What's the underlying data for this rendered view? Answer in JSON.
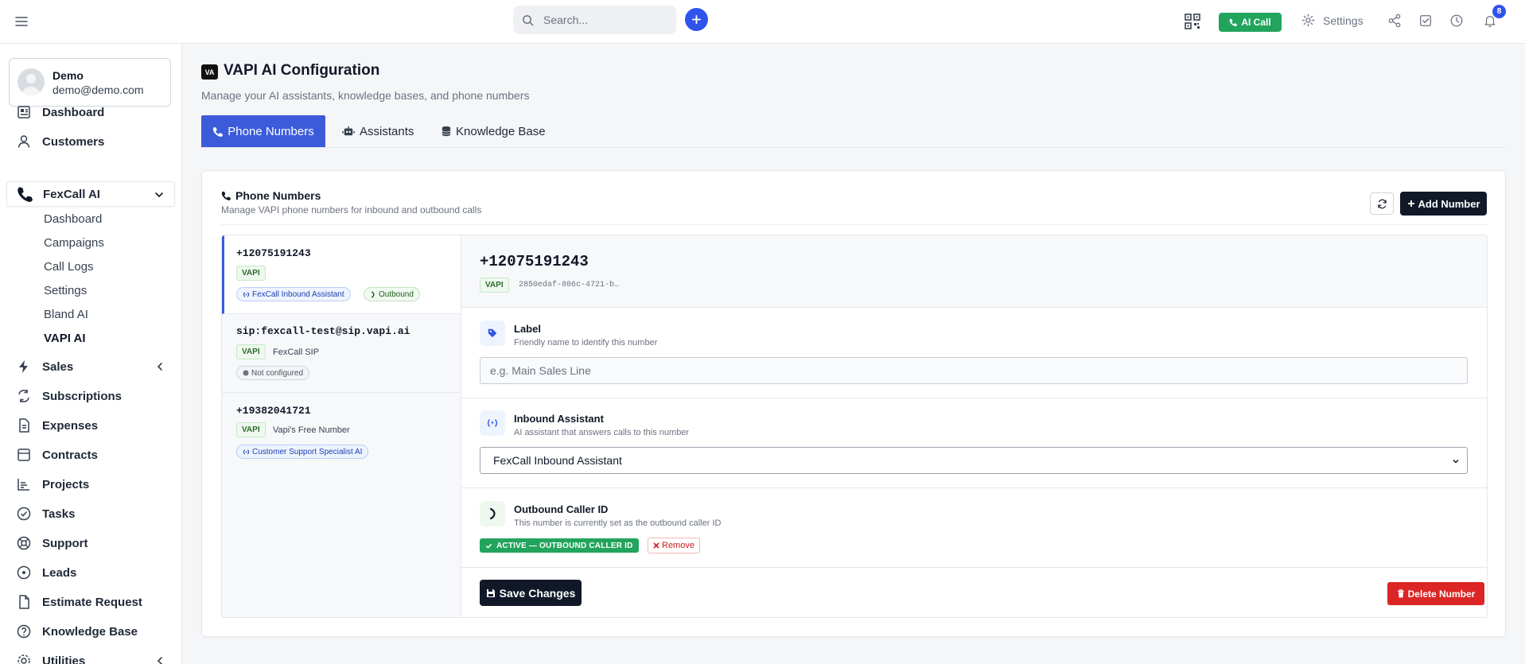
{
  "topbar": {
    "search_placeholder": "Search...",
    "ai_call_label": "AI Call",
    "settings_label": "Settings",
    "notification_count": "8",
    "accent_color": "#2f54eb",
    "green_color": "#22a45d"
  },
  "user": {
    "name": "Demo",
    "email": "demo@demo.com"
  },
  "sidebar": {
    "items": [
      {
        "label": "Dashboard",
        "icon": "dashboard-icon"
      },
      {
        "label": "Customers",
        "icon": "user-icon"
      },
      {
        "label": "FexCall AI",
        "icon": "phone-icon",
        "expanded": true
      },
      {
        "label": "Sales",
        "icon": "bolt-icon"
      },
      {
        "label": "Subscriptions",
        "icon": "repeat-icon"
      },
      {
        "label": "Expenses",
        "icon": "file-icon"
      },
      {
        "label": "Contracts",
        "icon": "contract-icon"
      },
      {
        "label": "Projects",
        "icon": "chart-icon"
      },
      {
        "label": "Tasks",
        "icon": "check-circle-icon"
      },
      {
        "label": "Support",
        "icon": "lifebuoy-icon"
      },
      {
        "label": "Leads",
        "icon": "target-icon"
      },
      {
        "label": "Estimate Request",
        "icon": "document-icon"
      },
      {
        "label": "Knowledge Base",
        "icon": "question-icon"
      },
      {
        "label": "Utilities",
        "icon": "gear-icon"
      }
    ],
    "subitems": [
      "Dashboard",
      "Campaigns",
      "Call Logs",
      "Settings",
      "Bland AI",
      "VAPI AI"
    ]
  },
  "page": {
    "icon_text": "VA",
    "title": "VAPI AI Configuration",
    "subtitle": "Manage your AI assistants, knowledge bases, and phone numbers"
  },
  "tabs": [
    {
      "label": "Phone Numbers",
      "active": true
    },
    {
      "label": "Assistants",
      "active": false
    },
    {
      "label": "Knowledge Base",
      "active": false
    }
  ],
  "panel": {
    "title": "Phone Numbers",
    "subtitle": "Manage VAPI phone numbers for inbound and outbound calls",
    "add_label": "Add Number"
  },
  "numbers": [
    {
      "number": "+12075191243",
      "provider": "VAPI",
      "chips": [
        {
          "text": "FexCall Inbound Assistant",
          "style": "blue",
          "icon": "waves-icon"
        },
        {
          "text": "Outbound",
          "style": "green",
          "icon": "phone-icon"
        }
      ]
    },
    {
      "number": "sip:fexcall-test@sip.vapi.ai",
      "provider": "VAPI",
      "desc": "FexCall SIP",
      "chips": [
        {
          "text": "Not configured",
          "style": "gray",
          "icon": "dot-icon"
        }
      ]
    },
    {
      "number": "+19382041721",
      "provider": "VAPI",
      "desc": "Vapi's Free Number",
      "chips": [
        {
          "text": "Customer Support Specialist AI",
          "style": "blue",
          "icon": "waves-icon"
        }
      ]
    }
  ],
  "detail": {
    "number": "+12075191243",
    "provider": "VAPI",
    "id": "2850edaf-806c-4721-b…",
    "label_section": {
      "title": "Label",
      "subtitle": "Friendly name to identify this number",
      "placeholder": "e.g. Main Sales Line",
      "value": ""
    },
    "inbound_section": {
      "title": "Inbound Assistant",
      "subtitle": "AI assistant that answers calls to this number",
      "selected": "FexCall Inbound Assistant"
    },
    "outbound_section": {
      "title": "Outbound Caller ID",
      "subtitle": "This number is currently set as the outbound caller ID",
      "status": "ACTIVE — OUTBOUND CALLER ID",
      "remove_label": "Remove"
    },
    "save_label": "Save Changes",
    "delete_label": "Delete Number"
  }
}
